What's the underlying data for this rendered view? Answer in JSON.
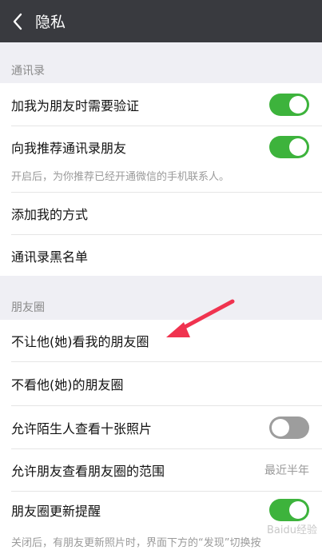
{
  "header": {
    "title": "隐私",
    "back_icon": "chevron-left-icon"
  },
  "sections": {
    "contacts": {
      "label": "通讯录",
      "items": {
        "verify": {
          "label": "加我为朋友时需要验证",
          "toggle": "on"
        },
        "recommend": {
          "label": "向我推荐通讯录朋友",
          "toggle": "on"
        },
        "recommend_note": "开启后，为你推荐已经开通微信的手机联系人。",
        "add_methods": {
          "label": "添加我的方式"
        },
        "blacklist": {
          "label": "通讯录黑名单"
        }
      }
    },
    "moments": {
      "label": "朋友圈",
      "items": {
        "hide_from": {
          "label": "不让他(她)看我的朋友圈"
        },
        "dont_see": {
          "label": "不看他(她)的朋友圈"
        },
        "strangers": {
          "label": "允许陌生人查看十张照片",
          "toggle": "off"
        },
        "range": {
          "label": "允许朋友查看朋友圈的范围",
          "value": "最近半年"
        },
        "update_remind": {
          "label": "朋友圈更新提醒",
          "toggle": "on"
        },
        "update_note": "关闭后，有朋友更新照片时，界面下方的“发现”切换按"
      }
    }
  },
  "colors": {
    "header_bg": "#393a3f",
    "toggle_on": "#3db33c",
    "toggle_off": "#9d9d9d",
    "arrow": "#f0334f"
  },
  "watermark": "Baidu经验"
}
